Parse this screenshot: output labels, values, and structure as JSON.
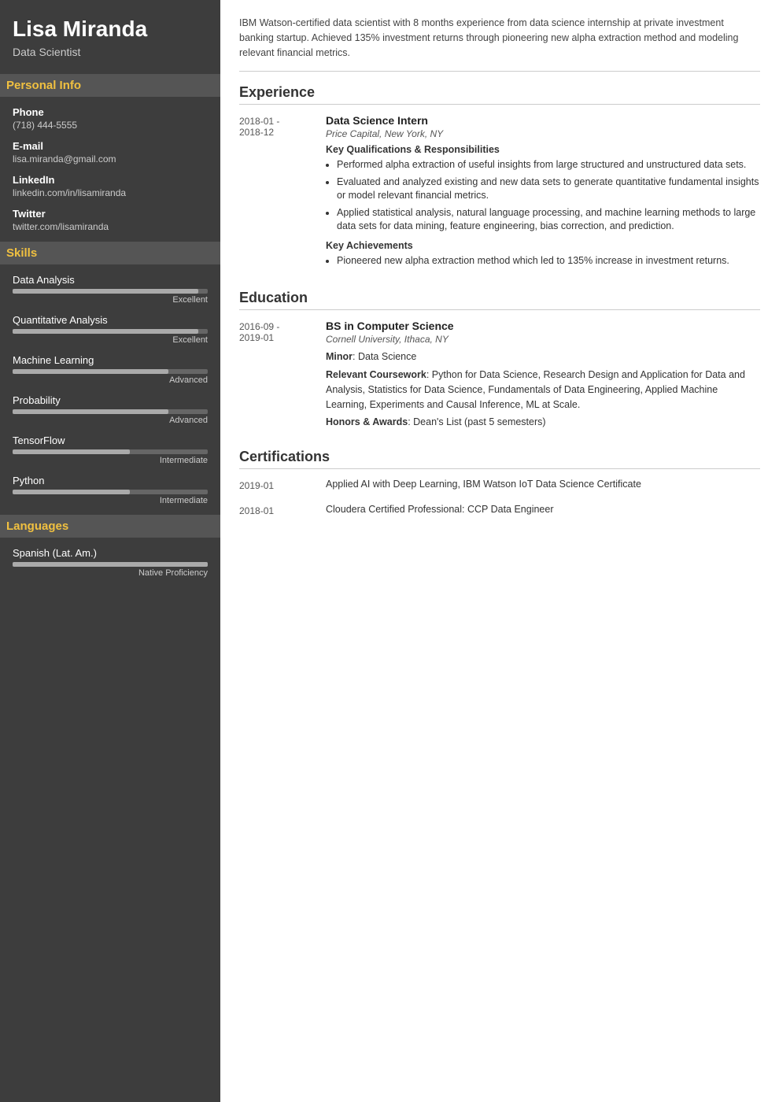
{
  "sidebar": {
    "name": "Lisa Miranda",
    "title": "Data Scientist",
    "sections": {
      "personal_info": {
        "label": "Personal Info",
        "fields": [
          {
            "label": "Phone",
            "value": "(718) 444-5555"
          },
          {
            "label": "E-mail",
            "value": "lisa.miranda@gmail.com"
          },
          {
            "label": "LinkedIn",
            "value": "linkedin.com/in/lisamiranda"
          },
          {
            "label": "Twitter",
            "value": "twitter.com/lisamiranda"
          }
        ]
      },
      "skills": {
        "label": "Skills",
        "items": [
          {
            "name": "Data Analysis",
            "level": "Excellent",
            "percent": 95
          },
          {
            "name": "Quantitative Analysis",
            "level": "Excellent",
            "percent": 95
          },
          {
            "name": "Machine Learning",
            "level": "Advanced",
            "percent": 80
          },
          {
            "name": "Probability",
            "level": "Advanced",
            "percent": 80
          },
          {
            "name": "TensorFlow",
            "level": "Intermediate",
            "percent": 60
          },
          {
            "name": "Python",
            "level": "Intermediate",
            "percent": 60
          }
        ]
      },
      "languages": {
        "label": "Languages",
        "items": [
          {
            "name": "Spanish (Lat. Am.)",
            "level": "Native Proficiency",
            "percent": 100
          }
        ]
      }
    }
  },
  "main": {
    "summary": "IBM Watson-certified data scientist with 8 months experience from data science internship at private investment banking startup. Achieved 135% investment returns through pioneering new alpha extraction method and modeling relevant financial metrics.",
    "experience": {
      "label": "Experience",
      "entries": [
        {
          "date": "2018-01 -\n2018-12",
          "title": "Data Science Intern",
          "subtitle": "Price Capital, New York, NY",
          "qualifications_label": "Key Qualifications & Responsibilities",
          "qualifications": [
            "Performed alpha extraction of useful insights from large structured and unstructured data sets.",
            "Evaluated and analyzed existing and new data sets to generate quantitative fundamental insights or model relevant financial metrics.",
            "Applied statistical analysis, natural language processing, and machine learning methods to large data sets for data mining, feature engineering, bias correction, and prediction."
          ],
          "achievements_label": "Key Achievements",
          "achievements": [
            "Pioneered new alpha extraction method which led to 135% increase in investment returns."
          ]
        }
      ]
    },
    "education": {
      "label": "Education",
      "entries": [
        {
          "date": "2016-09 -\n2019-01",
          "title": "BS in Computer Science",
          "subtitle": "Cornell University, Ithaca, NY",
          "minor_label": "Minor",
          "minor": "Data Science",
          "coursework_label": "Relevant Coursework",
          "coursework": "Python for Data Science, Research Design and Application for Data and Analysis, Statistics for Data Science, Fundamentals of Data Engineering, Applied Machine Learning, Experiments and Causal Inference, ML at Scale.",
          "honors_label": "Honors & Awards",
          "honors": "Dean's List (past 5 semesters)"
        }
      ]
    },
    "certifications": {
      "label": "Certifications",
      "entries": [
        {
          "date": "2019-01",
          "title": "Applied AI with Deep Learning, IBM Watson IoT Data Science Certificate"
        },
        {
          "date": "2018-01",
          "title": "Cloudera Certified Professional: CCP Data Engineer"
        }
      ]
    }
  }
}
